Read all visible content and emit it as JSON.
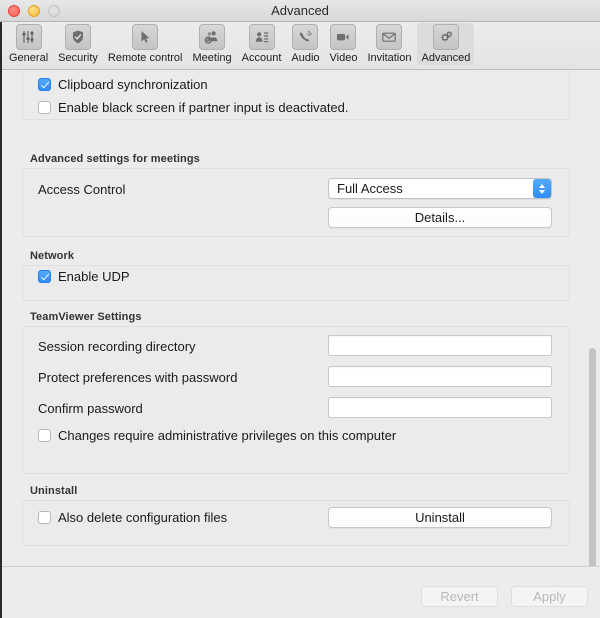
{
  "window": {
    "title": "Advanced",
    "traffic_lights": [
      "close-button",
      "minimize-button",
      "zoom-button"
    ]
  },
  "toolbar": {
    "items": [
      {
        "label": "General",
        "icon": "sliders-icon",
        "selected": false
      },
      {
        "label": "Security",
        "icon": "shield-check-icon",
        "selected": false
      },
      {
        "label": "Remote control",
        "icon": "cursor-arrow-icon",
        "selected": false
      },
      {
        "label": "Meeting",
        "icon": "people-group-icon",
        "selected": false
      },
      {
        "label": "Account",
        "icon": "contact-card-icon",
        "selected": false
      },
      {
        "label": "Audio",
        "icon": "phone-handset-icon",
        "selected": false
      },
      {
        "label": "Video",
        "icon": "video-camera-icon",
        "selected": false
      },
      {
        "label": "Invitation",
        "icon": "envelope-icon",
        "selected": false
      },
      {
        "label": "Advanced",
        "icon": "gears-icon",
        "selected": true
      }
    ]
  },
  "content": {
    "top_panel": {
      "clipboard_sync": {
        "label": "Clipboard synchronization",
        "checked": true
      },
      "black_screen": {
        "label": "Enable black screen if partner input is deactivated.",
        "checked": false
      }
    },
    "meetings_section": {
      "title": "Advanced settings for meetings",
      "access_control_label": "Access Control",
      "access_control_value": "Full Access",
      "access_control_options": [
        "Full Access"
      ],
      "details_button": "Details..."
    },
    "network_section": {
      "title": "Network",
      "enable_udp": {
        "label": "Enable UDP",
        "checked": true
      }
    },
    "teamviewer_section": {
      "title": "TeamViewer Settings",
      "session_recording_label": "Session recording directory",
      "session_recording_value": "",
      "session_recording_placeholder": "",
      "protect_prefs_label": "Protect preferences with password",
      "protect_prefs_value": "",
      "protect_prefs_placeholder": "",
      "confirm_password_label": "Confirm password",
      "confirm_password_value": "",
      "confirm_password_placeholder": "",
      "admin_privileges": {
        "label": "Changes require administrative privileges on this computer",
        "checked": false
      }
    },
    "uninstall_section": {
      "title": "Uninstall",
      "delete_config": {
        "label": "Also delete configuration files",
        "checked": false
      },
      "uninstall_button": "Uninstall"
    }
  },
  "footer": {
    "revert_label": "Revert",
    "apply_label": "Apply",
    "revert_enabled": false,
    "apply_enabled": false
  },
  "colors": {
    "accent_blue": "#2f8cf5",
    "window_bg": "#ececec",
    "panel_bg": "#ebebeb",
    "disabled_text": "#b9b9b9"
  }
}
